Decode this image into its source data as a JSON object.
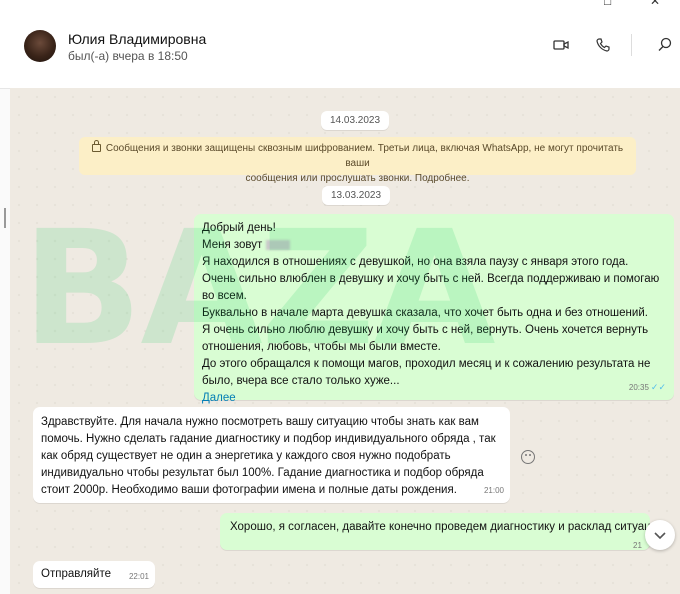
{
  "header": {
    "contact_name": "Юлия Владимировна",
    "status": "был(-а) вчера в 18:50",
    "icons": [
      "video-call-icon",
      "phone-icon",
      "search-icon"
    ]
  },
  "chat": {
    "date_chip_1": "14.03.2023",
    "encryption_notice_line1": "Сообщения и звонки защищены сквозным шифрованием. Третьи лица, включая WhatsApp, не могут прочитать ваши",
    "encryption_notice_line2": "сообщения или прослушать звонки. Подробнее.",
    "date_chip_2": "13.03.2023",
    "watermark": "BAZA",
    "messages": [
      {
        "direction": "out",
        "lines": [
          "Добрый день!",
          "Меня зовут",
          "Я находился в отношениях с девушкой, но она взяла паузу с января этого года.",
          "Очень сильно влюблен в девушку и хочу быть с ней. Всегда поддерживаю и помогаю",
          "во всем.",
          "Буквально в начале марта девушка сказала, что хочет быть одна и без отношений.",
          "Я очень сильно люблю девушку и хочу быть с ней, вернуть. Очень хочется вернуть",
          "отношения, любовь, чтобы мы были вместе.",
          "До этого обращался к помощи магов, проходил месяц и к сожалению результата не",
          "было, вчера все стало только хуже..."
        ],
        "read_more": "Далее",
        "time": "20:35"
      },
      {
        "direction": "in",
        "lines": [
          "Здравствуйте. Для начала нужно посмотреть вашу ситуацию чтобы знать как вам",
          "помочь. Нужно сделать гадание диагностику и подбор индивидуального обряда , так",
          "как обряд существует не один а энергетика у каждого своя нужно подобрать",
          "индивидуально чтобы результат был 100%. Гадание диагностика и подбор обряда",
          "стоит 2000р.  Необходимо ваши фотографии имена и полные даты рождения."
        ],
        "time": "21:00"
      },
      {
        "direction": "out",
        "lines": [
          "Хорошо, я согласен, давайте конечно проведем диагностику и расклад ситуац"
        ],
        "time": "21"
      },
      {
        "direction": "in",
        "lines": [
          "Отправляйте"
        ],
        "time": "22:01"
      }
    ]
  },
  "colors": {
    "outgoing": "#d9fdd3",
    "incoming": "#ffffff",
    "notice": "#fcefc7",
    "link": "#027eb5"
  }
}
